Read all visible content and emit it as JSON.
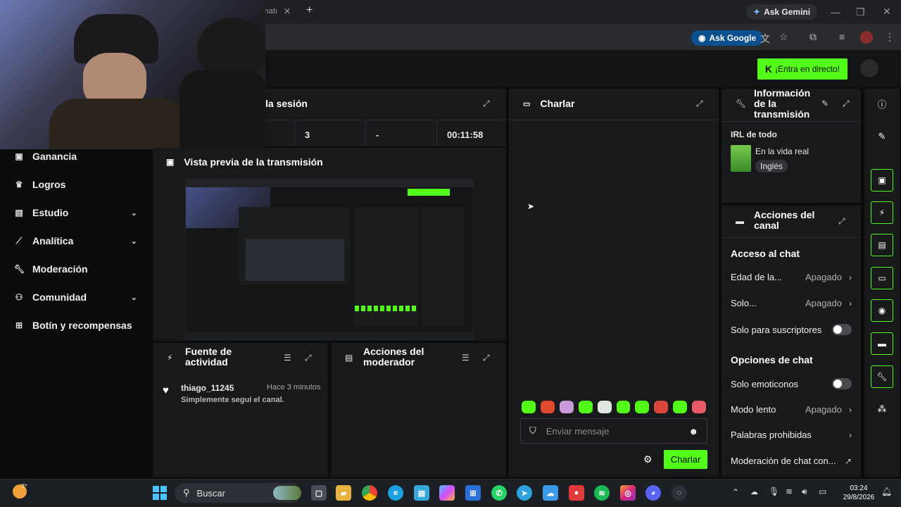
{
  "browser": {
    "tab_title_fragment": "rnatı",
    "new_tab_symbol": "+",
    "ask_gemini": "Ask Gemini",
    "ask_google": "Ask Google"
  },
  "header": {
    "go_live_label": "¡Entra en directo!"
  },
  "sidebar": {
    "items": [
      {
        "label": "Ganancia",
        "icon": "earnings-icon",
        "has_chevron": false
      },
      {
        "label": "Logros",
        "icon": "trophy-icon",
        "has_chevron": false
      },
      {
        "label": "Estudio",
        "icon": "studio-icon",
        "has_chevron": true
      },
      {
        "label": "Analítica",
        "icon": "analytics-icon",
        "has_chevron": true
      },
      {
        "label": "Moderación",
        "icon": "wrench-icon",
        "has_chevron": false
      },
      {
        "label": "Comunidad",
        "icon": "community-icon",
        "has_chevron": true
      },
      {
        "label": "Botín y recompensas",
        "icon": "gift-icon",
        "has_chevron": false
      }
    ]
  },
  "session": {
    "title": "la sesión",
    "stats": [
      "3",
      "-",
      "00:11:58"
    ]
  },
  "preview": {
    "title": "Vista previa de la transmisión"
  },
  "activity": {
    "title_line1": "Fuente de",
    "title_line2": "actividad",
    "events": [
      {
        "user": "thiago_11245",
        "time": "Hace 3 minutos",
        "text": "Simplemente seguí el canal."
      }
    ]
  },
  "mod_actions": {
    "title_line1": "Acciones del",
    "title_line2": "moderador"
  },
  "chat": {
    "title": "Charlar",
    "input_placeholder": "Enviar mensaje",
    "send_label": "Charlar"
  },
  "stream_info": {
    "title_line1": "Información",
    "title_line2": "de la",
    "title_line3": "transmisión",
    "stream_title": "IRL de todo",
    "category": "En la vida real",
    "language": "Inglés"
  },
  "channel_actions": {
    "title_line1": "Acciones del",
    "title_line2": "canal",
    "chat_access_heading": "Acceso al chat",
    "age_label": "Edad de la...",
    "age_value": "Apagado",
    "solo_label": "Solo...",
    "solo_value": "Apagado",
    "subs_only_label": "Solo para suscriptores",
    "chat_options_heading": "Opciones de chat",
    "emotes_only_label": "Solo emoticonos",
    "slow_mode_label": "Modo lento",
    "slow_mode_value": "Apagado",
    "banned_words_label": "Palabras prohibidas",
    "chat_mod_label": "Moderación de chat con..."
  },
  "taskbar": {
    "search_label": "Buscar",
    "weather_temp": "7°",
    "time": "03:24",
    "date": "29/8/2026"
  },
  "colors": {
    "accent": "#53fc18",
    "panel": "#18191b",
    "background": "#0b0c0d"
  }
}
